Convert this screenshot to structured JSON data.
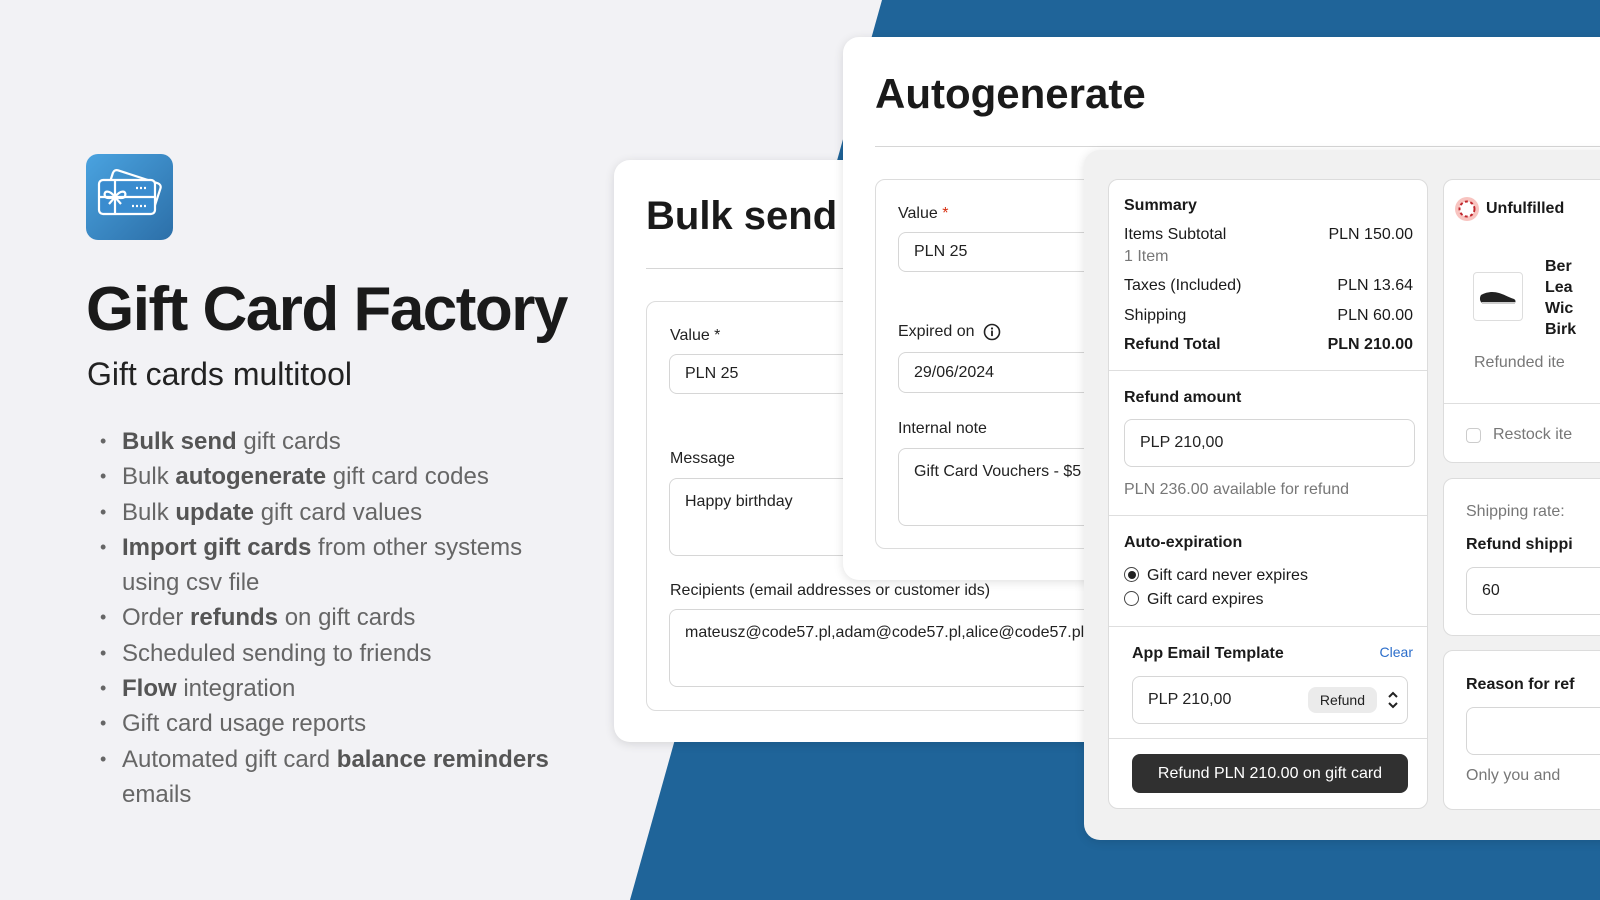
{
  "colors": {
    "background": "#f2f2f5",
    "brand_blue": "#1f6499",
    "icon_gradient": [
      "#4aa3e0",
      "#2c6fa8"
    ],
    "button_dark": "#303030",
    "link": "#2c6ecb",
    "required": "#d72c0d"
  },
  "hero": {
    "app_name": "Gift Card Factory",
    "tagline": "Gift cards multitool",
    "icon": "gift-card-icon",
    "features": [
      [
        {
          "b": "Bulk send"
        },
        {
          "t": " gift cards"
        }
      ],
      [
        {
          "t": "Bulk "
        },
        {
          "b": "autogenerate"
        },
        {
          "t": " gift card codes"
        }
      ],
      [
        {
          "t": "Bulk "
        },
        {
          "b": "update"
        },
        {
          "t": " gift card values"
        }
      ],
      [
        {
          "b": "Import gift cards"
        },
        {
          "t": " from other systems using csv file"
        }
      ],
      [
        {
          "t": "Order "
        },
        {
          "b": "refunds"
        },
        {
          "t": " on gift cards"
        }
      ],
      [
        {
          "t": "Scheduled sending to friends"
        }
      ],
      [
        {
          "b": "Flow"
        },
        {
          "t": " integration"
        }
      ],
      [
        {
          "t": "Gift card usage reports"
        }
      ],
      [
        {
          "t": "Automated gift card "
        },
        {
          "b": "balance reminders"
        },
        {
          "t": " emails"
        }
      ]
    ]
  },
  "bulk_send": {
    "title": "Bulk send",
    "value_label": "Value *",
    "value": "PLN 25",
    "message_label": "Message",
    "message": "Happy birthday",
    "recipients_label": "Recipients (email addresses or customer ids)",
    "recipients": "mateusz@code57.pl,adam@code57.pl,alice@code57.pl"
  },
  "autogenerate": {
    "title": "Autogenerate",
    "value_label": "Value",
    "required_mark": "*",
    "value": "PLN 25",
    "expired_label": "Expired on",
    "expired": "29/06/2024",
    "note_label": "Internal note",
    "note": "Gift Card Vouchers - $5"
  },
  "refund": {
    "summary": {
      "title": "Summary",
      "items_subtotal_label": "Items Subtotal",
      "items_subtotal": "PLN 150.00",
      "items_count": "1 Item",
      "taxes_label": "Taxes (Included)",
      "taxes": "PLN 13.64",
      "shipping_label": "Shipping",
      "shipping": "PLN 60.00",
      "total_label": "Refund Total",
      "total": "PLN 210.00"
    },
    "refund_amount_label": "Refund amount",
    "refund_amount": "PLP 210,00",
    "available": "PLN 236.00 available for refund",
    "auto_expiration_label": "Auto-expiration",
    "options": [
      "Gift card never expires",
      "Gift card expires"
    ],
    "selected_option": 0,
    "template_label": "App Email Template",
    "clear": "Clear",
    "template_value": "PLP 210,00",
    "template_badge": "Refund",
    "submit": "Refund PLN 210.00 on gift card",
    "unfulfilled": "Unfulfilled",
    "product_lines": [
      "Ber",
      "Lea",
      "Wic",
      "Birk"
    ],
    "refunded_items": "Refunded ite",
    "restock": "Restock ite",
    "shipping_rate": "Shipping rate:",
    "refund_shipping": "Refund shippi",
    "refund_shipping_value": "60",
    "reason": "Reason for ref",
    "reason_help": "Only you and"
  }
}
